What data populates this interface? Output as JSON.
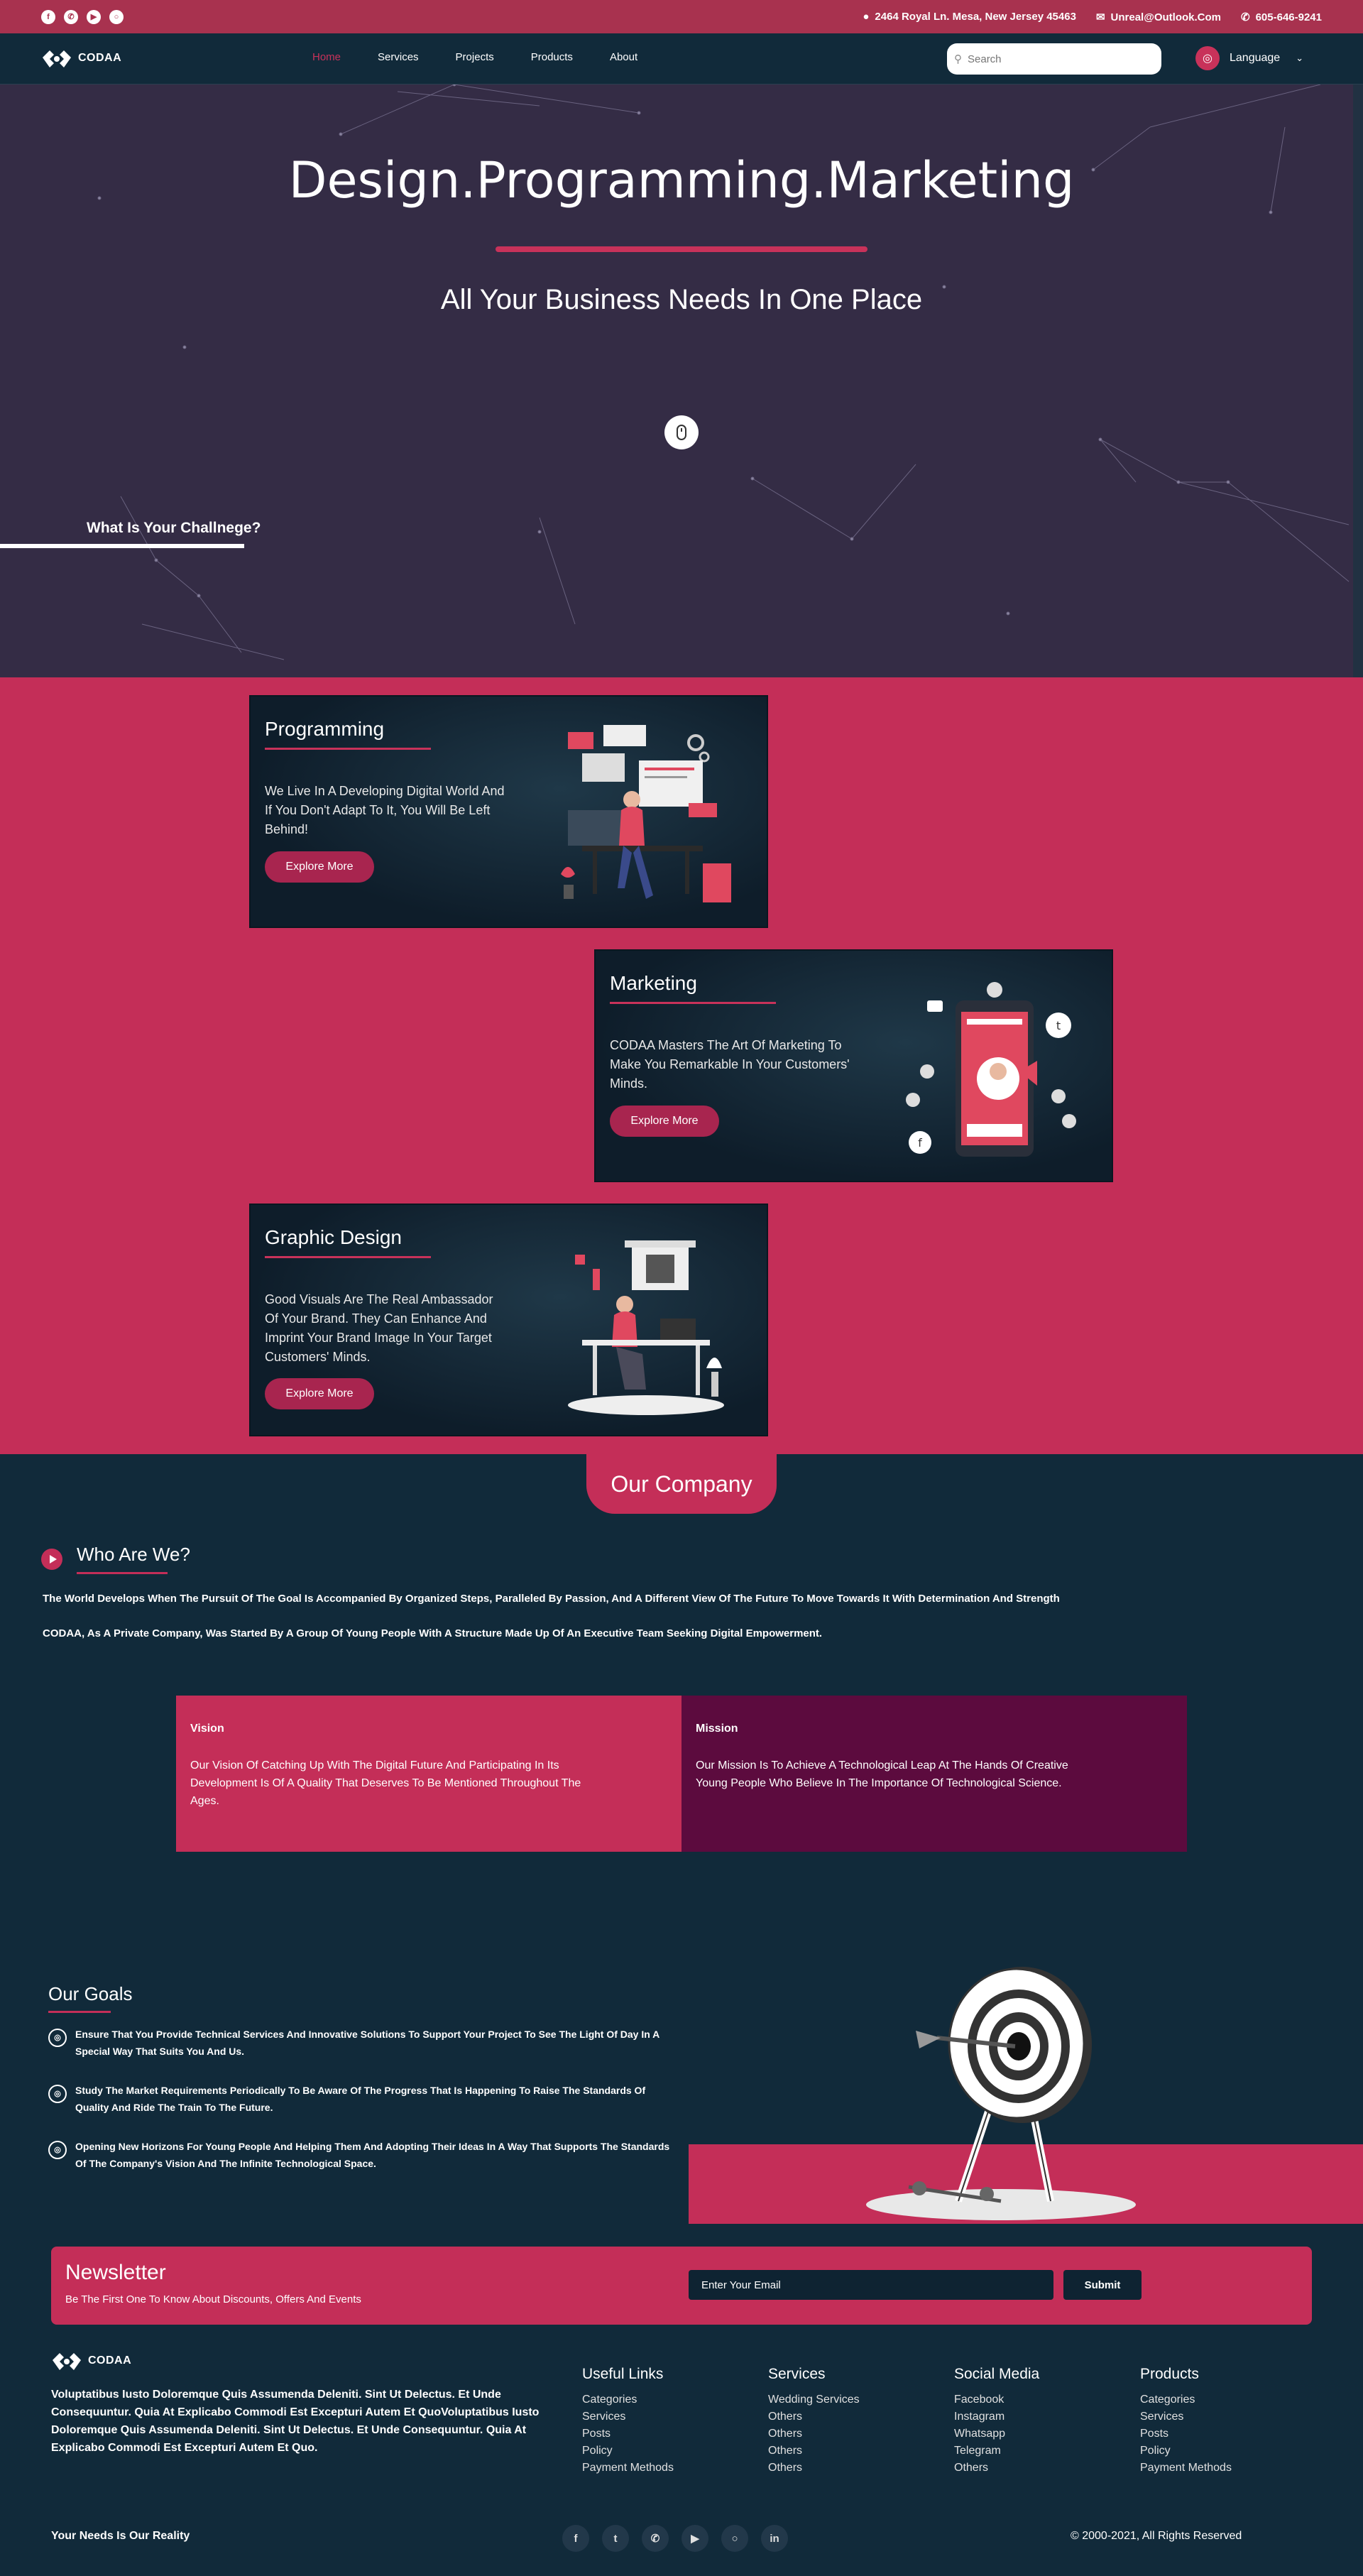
{
  "topbar": {
    "socials": [
      "facebook-icon",
      "whatsapp-icon",
      "youtube-icon",
      "instagram-icon"
    ],
    "address": "2464 Royal Ln. Mesa, New Jersey 45463",
    "email": "Unreal@Outlook.Com",
    "phone": "605-646-9241"
  },
  "nav": {
    "logo_text": "CODAA",
    "links": [
      "Home",
      "Services",
      "Projects",
      "Products",
      "About"
    ],
    "active": "Home",
    "search_placeholder": "Search",
    "language_label": "Language"
  },
  "hero": {
    "title": "Design.Programming.Marketing",
    "subtitle": "All Your Business Needs In One Place",
    "challenge": "What Is Your Challnege?"
  },
  "services": [
    {
      "title": "Programming",
      "text": "We Live In A Developing Digital World And If You Don't Adapt To It, You Will Be Left Behind!",
      "button": "Explore More"
    },
    {
      "title": "Marketing",
      "text": "CODAA Masters The Art Of Marketing To Make You Remarkable In Your Customers' Minds.",
      "button": "Explore More"
    },
    {
      "title": "Graphic Design",
      "text": "Good Visuals Are The Real Ambassador Of Your Brand. They Can Enhance And Imprint Your Brand Image In Your Target Customers' Minds.",
      "button": "Explore More"
    }
  ],
  "company": {
    "tab": "Our Company",
    "who_title": "Who Are We?",
    "p1": "The World Develops When The Pursuit Of The Goal Is Accompanied By Organized Steps, Paralleled By Passion, And A Different View Of The Future To Move Towards It With Determination And Strength",
    "p2": "CODAA, As A Private Company, Was Started By A Group Of Young People With A Structure Made Up Of An Executive Team Seeking Digital Empowerment.",
    "vision_title": "Vision",
    "vision_text": "Our Vision Of Catching Up With The Digital Future And Participating In Its Development Is Of A Quality That Deserves To Be Mentioned Throughout The Ages.",
    "mission_title": "Mission",
    "mission_text": "Our Mission Is To Achieve A Technological Leap At The Hands Of Creative Young People Who Believe In The Importance Of Technological Science.",
    "colors": {
      "vision": "#c42e58",
      "mission": "#5c0b3e"
    }
  },
  "goals": {
    "title": "Our Goals",
    "items": [
      "Ensure That You Provide Technical Services And Innovative Solutions To Support Your Project To See The Light Of Day In A Special Way That Suits You And Us.",
      "Study The Market Requirements Periodically To Be Aware Of The Progress That Is Happening To Raise The Standards Of Quality And Ride The Train To The Future.",
      "Opening New Horizons For Young People And Helping Them And Adopting Their Ideas In A Way That Supports The Standards Of The Company's Vision And The Infinite Technological Space."
    ]
  },
  "newsletter": {
    "title": "Newsletter",
    "subtitle": "Be The First One To Know About Discounts, Offers And Events",
    "placeholder": "Enter Your Email",
    "button": "Submit"
  },
  "footer": {
    "logo_text": "CODAA",
    "description": "Voluptatibus Iusto Doloremque Quis Assumenda Deleniti. Sint Ut Delectus. Et Unde Consequuntur. Quia At Explicabo Commodi Est Excepturi Autem Et QuoVoluptatibus Iusto Doloremque Quis Assumenda Deleniti. Sint Ut Delectus. Et Unde Consequuntur. Quia At Explicabo Commodi Est Excepturi Autem Et Quo.",
    "columns": [
      {
        "title": "Useful Links",
        "items": [
          "Categories",
          "Services",
          "Posts",
          "Policy",
          "Payment Methods"
        ]
      },
      {
        "title": "Services",
        "items": [
          "Wedding Services",
          "Others",
          "Others",
          "Others",
          "Others"
        ]
      },
      {
        "title": "Social Media",
        "items": [
          "Facebook",
          "Instagram",
          "Whatsapp",
          "Telegram",
          "Others"
        ]
      },
      {
        "title": "Products",
        "items": [
          "Categories",
          "Services",
          "Posts",
          "Policy",
          "Payment Methods"
        ]
      }
    ],
    "slogan": "Your Needs Is Our Reality",
    "bottom_socials": [
      "facebook-icon",
      "twitter-icon",
      "whatsapp-icon",
      "youtube-icon",
      "instagram-icon",
      "linkedin-icon"
    ],
    "copyright": "© 2000-2021, All Rights Reserved"
  }
}
